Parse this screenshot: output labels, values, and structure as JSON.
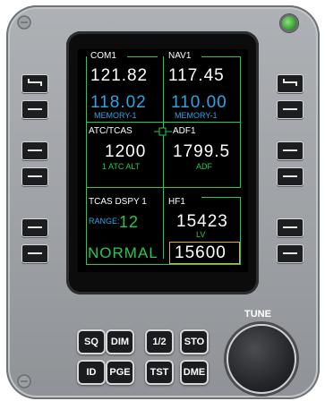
{
  "status_led": {
    "state": "on",
    "color": "#3fa83a"
  },
  "colors": {
    "white": "#ffffff",
    "blue": "#2aa6e8",
    "green": "#27c94a",
    "amber": "#e0a93a"
  },
  "line_select_keys": {
    "left": [
      "swap-icon",
      "blank",
      "blank",
      "blank",
      "blank",
      "blank"
    ],
    "right": [
      "swap-icon",
      "blank",
      "blank",
      "blank",
      "blank",
      "blank"
    ]
  },
  "screen": {
    "com1": {
      "title": "COM1",
      "active": "121.82",
      "standby": "118.02",
      "standby_label": "MEMORY-1"
    },
    "nav1": {
      "title": "NAV1",
      "active": "117.45",
      "standby": "110.00",
      "standby_label": "MEMORY-1"
    },
    "atc": {
      "title": "ATC/TCAS",
      "code": "1200",
      "sub_label": "1 ATC ALT"
    },
    "adf1": {
      "title": "ADF1",
      "freq": "1799.5",
      "sub_label": "ADF"
    },
    "tcas": {
      "title": "TCAS DSPY 1",
      "range_label": "RANGE:",
      "range_value": "12",
      "mode": "NORMAL"
    },
    "hf1": {
      "title": "HF1",
      "active": "15423",
      "active_label": "LV",
      "standby": "15600"
    }
  },
  "function_buttons": {
    "row1": [
      "SQ",
      "DIM",
      "1/2",
      "STO"
    ],
    "row2": [
      "ID",
      "PGE",
      "TST",
      "DME"
    ]
  },
  "tune": {
    "label": "TUNE"
  }
}
